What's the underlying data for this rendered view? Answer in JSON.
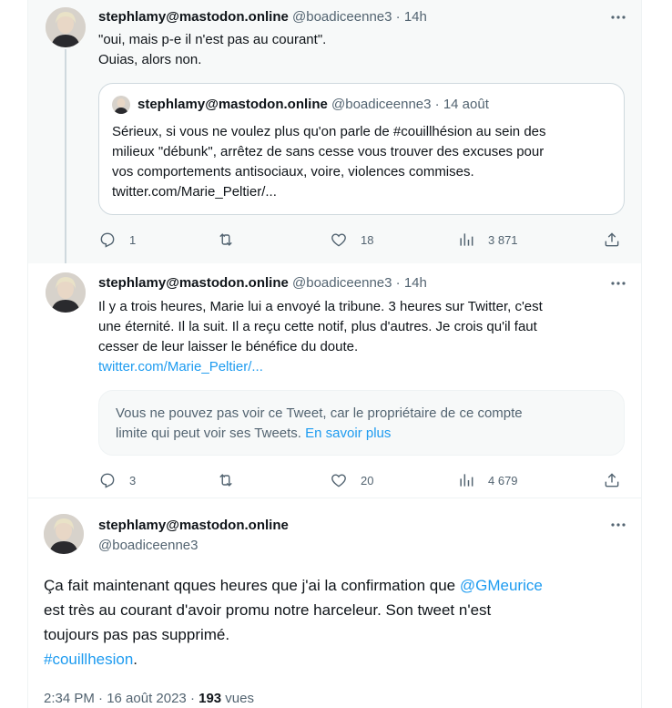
{
  "tweets": [
    {
      "name": "stephlamy@mastodon.online",
      "handle": "@boadiceenne3",
      "sep": "·",
      "time": "14h",
      "lines": [
        "\"oui, mais p-e il n'est pas au courant\".",
        "Ouias, alors non."
      ],
      "quote": {
        "name": "stephlamy@mastodon.online",
        "handle": "@boadiceenne3",
        "sep": "·",
        "time": "14 août",
        "line1": "Sérieux, si vous ne voulez plus qu'on parle de #couillhésion au sein des",
        "line2": "milieux \"débunk\", arrêtez de sans cesse vous trouver des excuses pour",
        "line3": "vos comportements antisociaux, voire, violences commises.",
        "line4": "twitter.com/Marie_Peltier/..."
      },
      "stats": {
        "replies": "1",
        "retweets": "",
        "likes": "18",
        "views": "3 871"
      }
    },
    {
      "name": "stephlamy@mastodon.online",
      "handle": "@boadiceenne3",
      "sep": "·",
      "time": "14h",
      "lines": [
        "Il y a trois heures, Marie lui a envoyé la tribune. 3 heures sur Twitter, c'est",
        "une éternité. Il la suit. Il a reçu cette notif, plus d'autres. Je crois qu'il faut",
        "cesser de leur laisser le bénéfice du doute."
      ],
      "link": "twitter.com/Marie_Peltier/...",
      "unavailable": {
        "line1": "Vous ne pouvez pas voir ce Tweet, car le propriétaire de ce compte",
        "line2": "limite qui peut voir ses Tweets.",
        "learn_more": "En savoir plus"
      },
      "stats": {
        "replies": "3",
        "retweets": "",
        "likes": "20",
        "views": "4 679"
      }
    }
  ],
  "main": {
    "name": "stephlamy@mastodon.online",
    "handle": "@boadiceenne3",
    "line1_pre": "Ça fait maintenant qques heures que j'ai la confirmation que ",
    "mention": "@GMeurice",
    "line2": "est très au courant d'avoir promu notre harceleur. Son tweet n'est",
    "line3": "toujours pas pas supprimé.",
    "hashtag": "#couillhesion",
    "after_hashtag": ".",
    "timestamp": "2:34 PM · 16 août 2023 · ",
    "views_count": "193",
    "views_label": " vues"
  },
  "colors": {
    "accent": "#1d9bf0",
    "secondary_text": "#536471",
    "border": "#cfd9de"
  },
  "icons": [
    "more-icon",
    "reply-icon",
    "retweet-icon",
    "like-icon",
    "views-icon",
    "share-icon"
  ]
}
